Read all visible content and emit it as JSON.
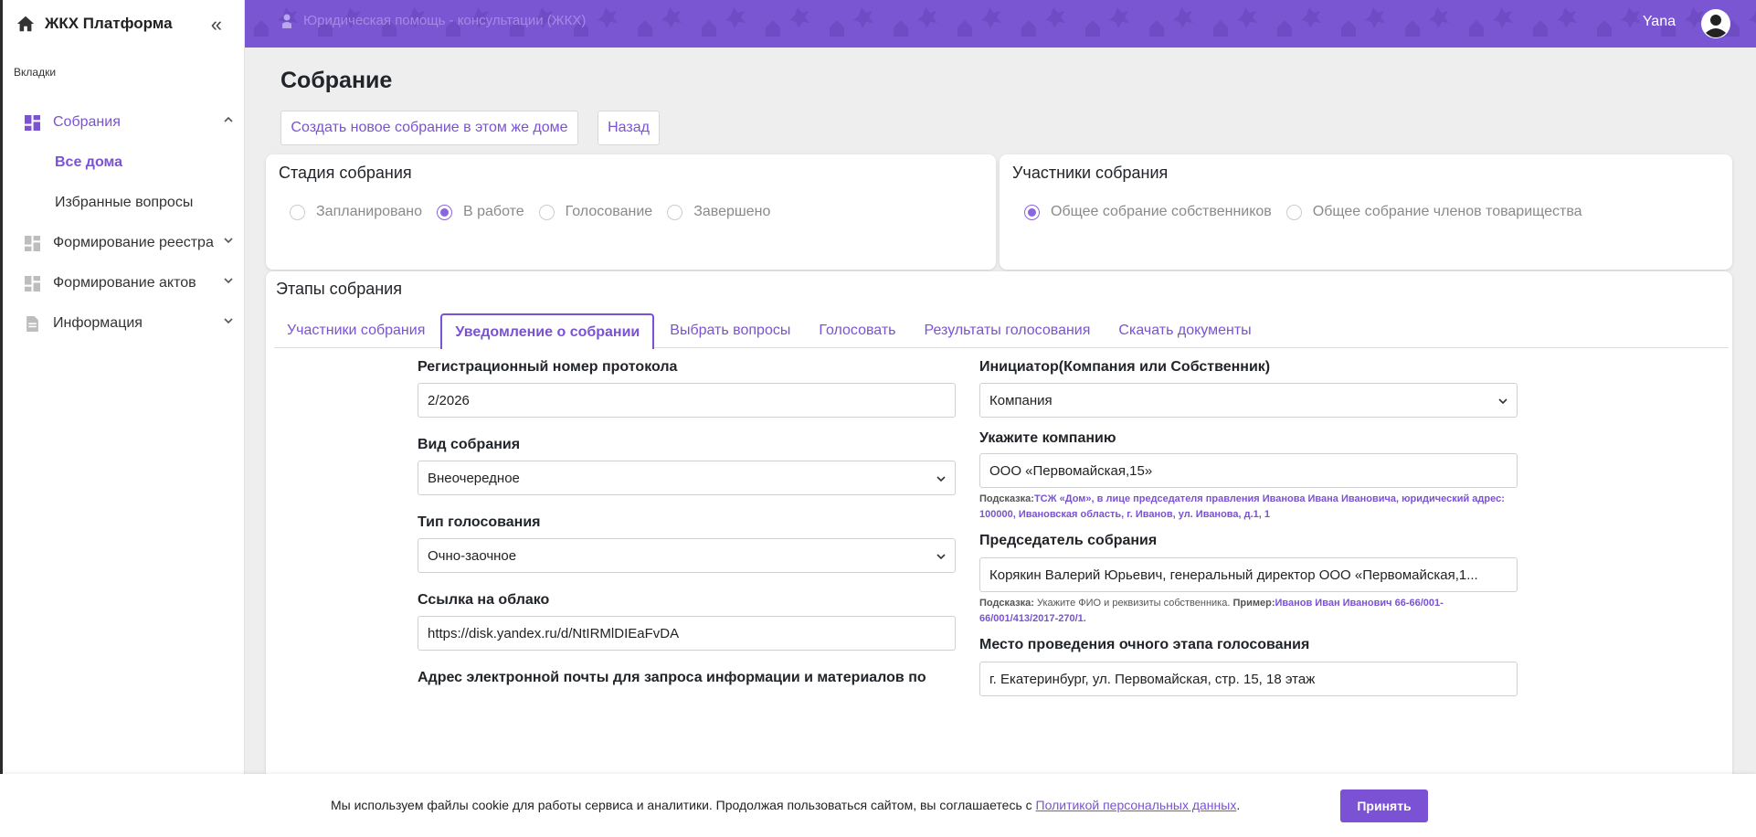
{
  "colors": {
    "accent": "#7b52d3",
    "topbar": "#7b56d2",
    "background": "#eeeeee"
  },
  "sidebar": {
    "brand": "ЖКХ Платформа",
    "section_label": "Вкладки",
    "groups": [
      {
        "label": "Собрания",
        "icon": "dashboard-grid-icon",
        "expanded": true,
        "children": [
          {
            "label": "Все дома",
            "current": true
          },
          {
            "label": "Избранные вопросы"
          }
        ]
      },
      {
        "label": "Формирование реестра",
        "icon": "dashboard-grid-icon"
      },
      {
        "label": "Формирование актов",
        "icon": "dashboard-grid-icon"
      },
      {
        "label": "Информация",
        "icon": "document-icon"
      }
    ]
  },
  "topbar": {
    "breadcrumb": "Юридическая помощь - консультации (ЖКХ)",
    "user_name": "Yana"
  },
  "page": {
    "title": "Собрание",
    "buttons": {
      "create_new": "Создать новое собрание в этом же доме",
      "back": "Назад"
    }
  },
  "stage": {
    "title": "Стадия собрания",
    "options": [
      "Запланировано",
      "В работе",
      "Голосование",
      "Завершено"
    ],
    "selected": "В работе"
  },
  "participants": {
    "title": "Участники собрания",
    "options": [
      "Общее собрание собственников",
      "Общее собрание членов товарищества"
    ],
    "selected": "Общее собрание собственников"
  },
  "steps": {
    "title": "Этапы собрания",
    "tabs": [
      "Участники собрания",
      "Уведомление о собрании",
      "Выбрать вопросы",
      "Голосовать",
      "Результаты голосования",
      "Скачать документы"
    ],
    "active_tab": "Уведомление о собрании"
  },
  "form": {
    "protocol_number": {
      "label": "Регистрационный номер протокола",
      "value": "2/2026"
    },
    "meeting_kind": {
      "label": "Вид собрания",
      "value": "Внеочередное"
    },
    "voting_type": {
      "label": "Тип голосования",
      "value": "Очно-заочное"
    },
    "cloud_link": {
      "label": "Ссылка на облако",
      "value": "https://disk.yandex.ru/d/NtIRMlDIEaFvDA"
    },
    "email_label": "Адрес электронной почты для запроса информации и материалов по",
    "initiator": {
      "label": "Инициатор(Компания или Собственник)",
      "value": "Компания"
    },
    "company": {
      "label": "Укажите компанию",
      "value": "ООО «Первомайская,15»",
      "hint_key": "Подсказка:",
      "hint_text": "ТСЖ «Дом», в лице председателя правления Иванова Ивана Ивановича, юридический адрес: 100000, Ивановская область, г. Иванов, ул. Иванова, д.1, 1"
    },
    "chairman": {
      "label": "Председатель собрания",
      "value": "Корякин Валерий Юрьевич, генеральный директор ООО «Первомайская,1...",
      "hint_key": "Подсказка:",
      "hint_normal": " Укажите ФИО и реквизиты собственника. ",
      "hint_example_key": "Пример:",
      "hint_example": "Иванов Иван Иванович 66-66/001-66/001/413/2017-270/1."
    },
    "venue": {
      "label": "Место проведения очного этапа голосования",
      "value": "г. Екатеринбург, ул. Первомайская, стр. 15, 18 этаж"
    }
  },
  "cookie": {
    "text": "Мы используем файлы cookie для работы сервиса и аналитики. Продолжая пользоваться сайтом, вы соглашаетесь с ",
    "link": "Политикой персональных данных",
    "tail": ".",
    "accept": "Принять"
  }
}
